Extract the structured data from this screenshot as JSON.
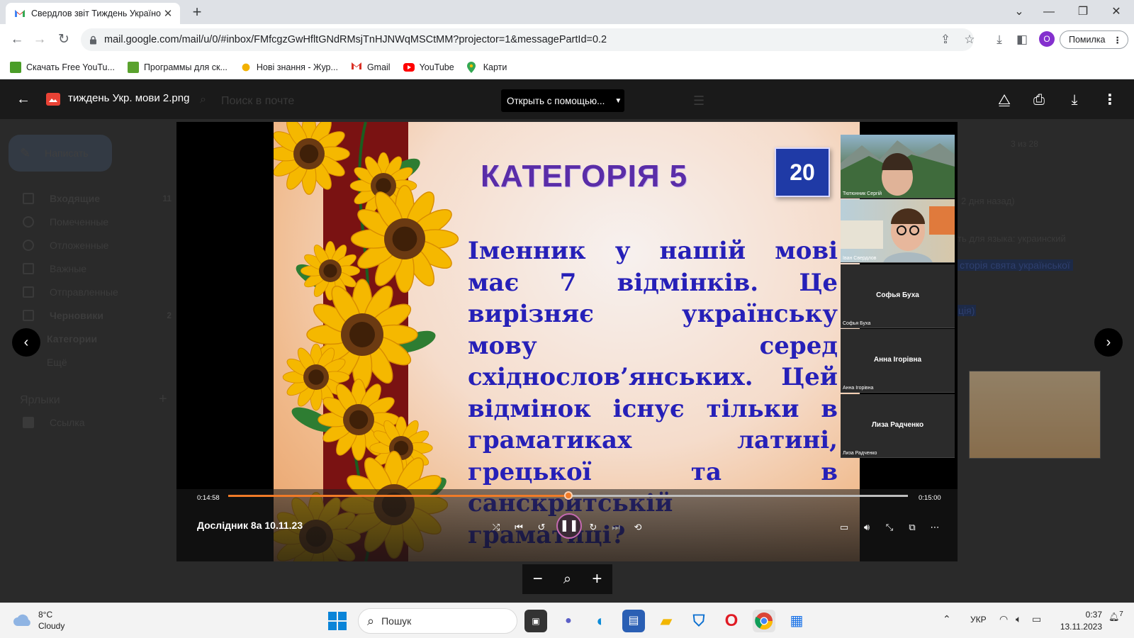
{
  "tab": {
    "title": "Свердлов звіт Тиждень Україно"
  },
  "omnibox": {
    "url": "mail.google.com/mail/u/0/#inbox/FMfcgzGwHfltGNdRMsjTnHJNWqMSCtMM?projector=1&messagePartId=0.2"
  },
  "profile": {
    "initial": "O"
  },
  "error_button": {
    "label": "Помилка"
  },
  "bookmarks": [
    {
      "label": "Скачать Free YouTu...",
      "color": "#4a9d28"
    },
    {
      "label": "Программы для ск...",
      "color": "#5aa22e"
    },
    {
      "label": "Нові знання - Жур...",
      "color": "#f2b100"
    },
    {
      "label": "Gmail",
      "color": "#d93025"
    },
    {
      "label": "YouTube",
      "color": "#ff0000"
    },
    {
      "label": "Карти",
      "color": "#34a853"
    }
  ],
  "viewer": {
    "file_name": "тиждень Укр. мови 2.png",
    "search_placeholder": "Поиск в почте",
    "open_with": "Открыть с помощью..."
  },
  "gmail_bg": {
    "compose": "Написать",
    "items": [
      {
        "label": "Входящие",
        "count": "11"
      },
      {
        "label": "Помеченные",
        "count": ""
      },
      {
        "label": "Отложенные",
        "count": ""
      },
      {
        "label": "Важные",
        "count": ""
      },
      {
        "label": "Отправленные",
        "count": ""
      },
      {
        "label": "Черновики",
        "count": "2"
      },
      {
        "label": "Категории",
        "count": ""
      },
      {
        "label": "Ещё",
        "count": ""
      }
    ],
    "labels_title": "Ярлыки",
    "label_link": "Ссылка",
    "pager": "3 из 28",
    "ago": "2 дня назад)",
    "translate": "ть для языка: украинский",
    "snippet": "сторія свята української",
    "snippet2": "ція)"
  },
  "slide": {
    "title": "КАТЕГОРІЯ 5",
    "badge": "20",
    "text": "Іменник у нашій мові має 7 відмінків. Це вирізняє українську мову серед східнослов’янських. Цей відмінок існує тільки в граматиках латині, грецької та в санскритській граматиці?"
  },
  "participants": [
    {
      "name": "Тютюнник Сергій",
      "video": true
    },
    {
      "name": "Іван Свердлов",
      "video": true
    },
    {
      "name": "Софья Буха",
      "video": false
    },
    {
      "name": "Анна Ігорівна",
      "video": false
    },
    {
      "name": "Лиза Радченко",
      "video": false
    }
  ],
  "player": {
    "current_time": "0:14:58",
    "duration": "0:15:00",
    "progress": 0.5,
    "title": "Дослідник 8а 10.11.23"
  },
  "taskbar": {
    "weather_temp": "8°C",
    "weather_desc": "Cloudy",
    "search": "Пошук",
    "lang": "УКР",
    "time": "0:37",
    "date": "13.11.2023",
    "notifications": "7"
  }
}
